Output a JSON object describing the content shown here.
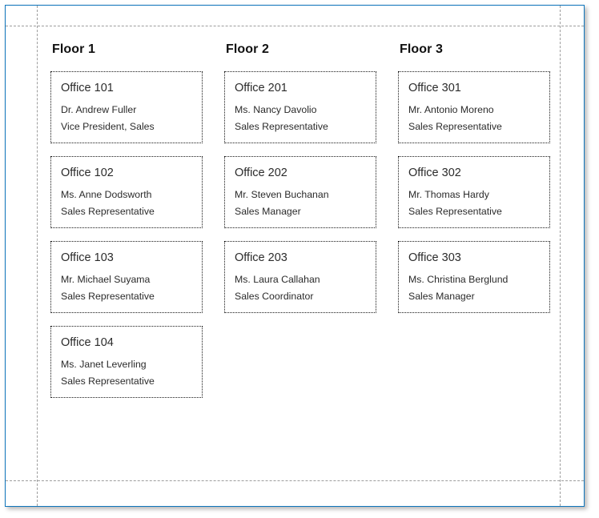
{
  "colors": {
    "window_border": "#0e75bb",
    "guide_line": "#9d9d9d",
    "card_border": "#1a1a1a",
    "heading_text": "#101010",
    "body_text": "#2b2b2b",
    "background": "#ffffff"
  },
  "floors": [
    {
      "title": "Floor 1",
      "offices": [
        {
          "name": "Office 101",
          "person": "Dr. Andrew Fuller",
          "role": "Vice President, Sales"
        },
        {
          "name": "Office 102",
          "person": "Ms. Anne Dodsworth",
          "role": "Sales Representative"
        },
        {
          "name": "Office 103",
          "person": "Mr. Michael Suyama",
          "role": "Sales Representative"
        },
        {
          "name": "Office 104",
          "person": "Ms. Janet Leverling",
          "role": "Sales Representative"
        }
      ]
    },
    {
      "title": "Floor 2",
      "offices": [
        {
          "name": "Office 201",
          "person": "Ms. Nancy Davolio",
          "role": "Sales Representative"
        },
        {
          "name": "Office 202",
          "person": "Mr. Steven Buchanan",
          "role": "Sales Manager"
        },
        {
          "name": "Office 203",
          "person": "Ms. Laura Callahan",
          "role": "Sales Coordinator"
        }
      ]
    },
    {
      "title": "Floor 3",
      "offices": [
        {
          "name": "Office 301",
          "person": "Mr. Antonio Moreno",
          "role": "Sales Representative"
        },
        {
          "name": "Office 302",
          "person": "Mr. Thomas Hardy",
          "role": "Sales Representative"
        },
        {
          "name": "Office 303",
          "person": "Ms. Christina Berglund",
          "role": "Sales Manager"
        }
      ]
    }
  ]
}
